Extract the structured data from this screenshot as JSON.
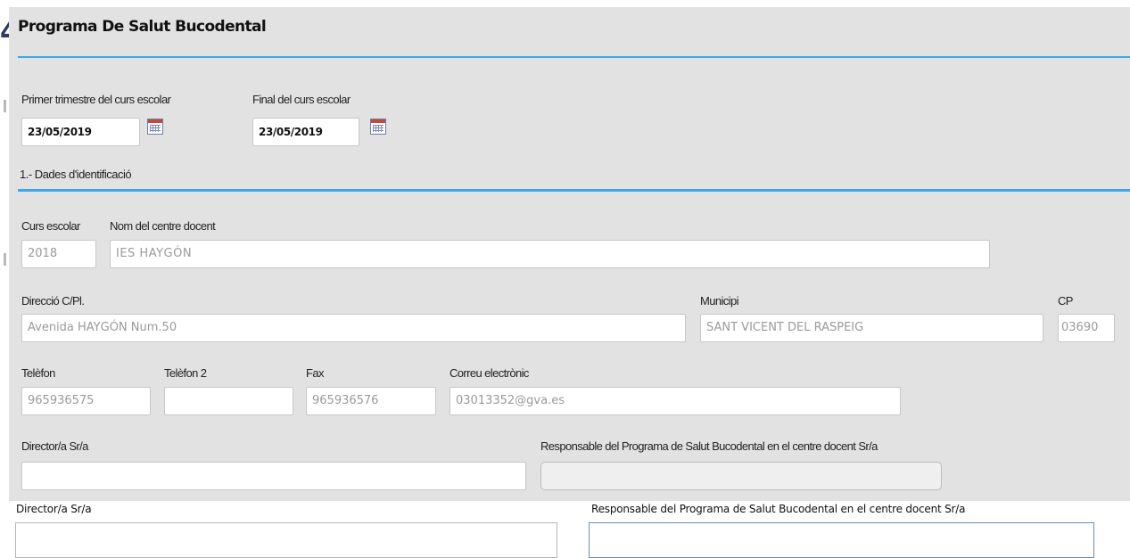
{
  "app": {
    "title": "Programa De Salut Bucodental"
  },
  "dates": {
    "primer_trimestre": {
      "label": "Primer trimestre del curs escolar",
      "value": "23/05/2019"
    },
    "final_curs": {
      "label": "Final del curs escolar",
      "value": "23/05/2019"
    }
  },
  "section1": {
    "title": "1.- Dades d'identificació"
  },
  "fields": {
    "curs_escolar": {
      "label": "Curs escolar",
      "value": "2018"
    },
    "nom_centre": {
      "label": "Nom del centre docent",
      "value": "IES HAYGÓN"
    },
    "direccio": {
      "label": "Direcció C/Pl.",
      "value": "Avenida HAYGÓN Num.50"
    },
    "municipi": {
      "label": "Municipi",
      "value": "SANT VICENT DEL RASPEIG"
    },
    "cp": {
      "label": "CP",
      "value": "03690"
    },
    "telefon": {
      "label": "Telèfon",
      "value": "965936575"
    },
    "telefon2": {
      "label": "Telèfon 2",
      "value": ""
    },
    "fax": {
      "label": "Fax",
      "value": "965936576"
    },
    "correu": {
      "label": "Correu electrònic",
      "value": "03013352@gva.es"
    },
    "director": {
      "label": "Director/a Sr/a",
      "value": ""
    },
    "responsable": {
      "label": "Responsable del Programa de Salut Bucodental en el centre docent Sr/a",
      "value": ""
    }
  },
  "underlay": {
    "director_label": "Director/a Sr/a",
    "responsable_label": "Responsable del Programa de Salut Bucodental en el centre docent Sr/a"
  },
  "icons": {
    "calendar": "calendar-icon"
  },
  "colors": {
    "accent_rule": "#3ea6e8",
    "panel_bg": "#e2e2e2"
  }
}
